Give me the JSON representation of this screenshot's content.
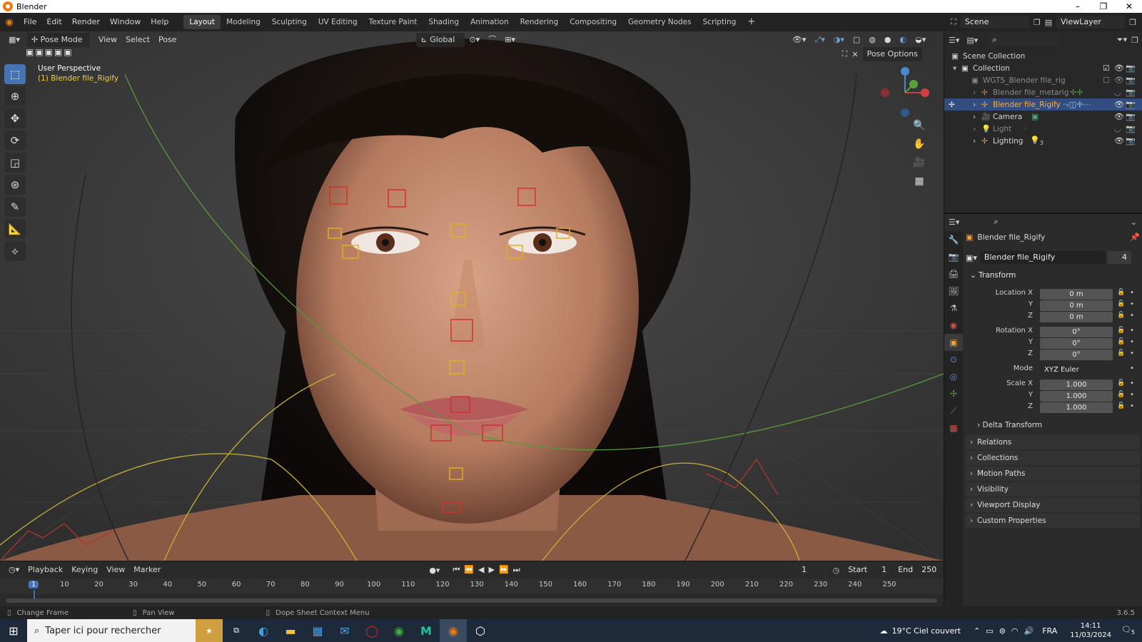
{
  "window": {
    "title": "Blender",
    "min": "–",
    "max": "❐",
    "close": "✕"
  },
  "menu": [
    "File",
    "Edit",
    "Render",
    "Window",
    "Help"
  ],
  "workspaces": [
    "Layout",
    "Modeling",
    "Sculpting",
    "UV Editing",
    "Texture Paint",
    "Shading",
    "Animation",
    "Rendering",
    "Compositing",
    "Geometry Nodes",
    "Scripting"
  ],
  "scene": {
    "label": "Scene",
    "viewlayer": "ViewLayer"
  },
  "viewport": {
    "mode": "Pose Mode",
    "menus": [
      "View",
      "Select",
      "Pose"
    ],
    "orientation": "Global",
    "pose_options": "Pose Options",
    "info_line1": "User Perspective",
    "info_line2": "(1) Blender file_Rigify"
  },
  "outliner": {
    "root": "Scene Collection",
    "items": [
      {
        "name": "Collection"
      },
      {
        "name": "WGTS_Blender file_rig"
      },
      {
        "name": "Blender file_metarig"
      },
      {
        "name": "Blender file_Rigify"
      },
      {
        "name": "Camera"
      },
      {
        "name": "Light"
      },
      {
        "name": "Lighting",
        "badge": "3"
      }
    ]
  },
  "properties": {
    "object_name": "Blender file_Rigify",
    "data_name": "Blender file_Rigify",
    "users": "4",
    "transform_title": "Transform",
    "location": {
      "label": "Location X",
      "x": "0 m",
      "y": "0 m",
      "z": "0 m"
    },
    "rotation": {
      "label": "Rotation X",
      "x": "0°",
      "y": "0°",
      "z": "0°"
    },
    "mode": {
      "label": "Mode",
      "value": "XYZ Euler"
    },
    "scale": {
      "label": "Scale X",
      "x": "1.000",
      "y": "1.000",
      "z": "1.000"
    },
    "axis_y": "Y",
    "axis_z": "Z",
    "delta": "Delta Transform",
    "panels": [
      "Relations",
      "Collections",
      "Motion Paths",
      "Visibility",
      "Viewport Display",
      "Custom Properties"
    ]
  },
  "timeline": {
    "menus": [
      "Playback",
      "Keying",
      "View",
      "Marker"
    ],
    "current_frame": "1",
    "start_label": "Start",
    "start": "1",
    "end_label": "End",
    "end": "250",
    "ticks": [
      "1",
      "10",
      "20",
      "30",
      "40",
      "50",
      "60",
      "70",
      "80",
      "90",
      "100",
      "110",
      "120",
      "130",
      "140",
      "150",
      "160",
      "170",
      "180",
      "190",
      "200",
      "210",
      "220",
      "230",
      "240",
      "250"
    ]
  },
  "status": {
    "change_frame": "Change Frame",
    "pan_view": "Pan View",
    "context_menu": "Dope Sheet Context Menu",
    "version": "3.6.5"
  },
  "taskbar": {
    "search_placeholder": "Taper ici pour rechercher",
    "weather": "19°C  Ciel couvert",
    "lang": "FRA",
    "time": "14:11",
    "date": "11/03/2024",
    "notif": "5"
  }
}
